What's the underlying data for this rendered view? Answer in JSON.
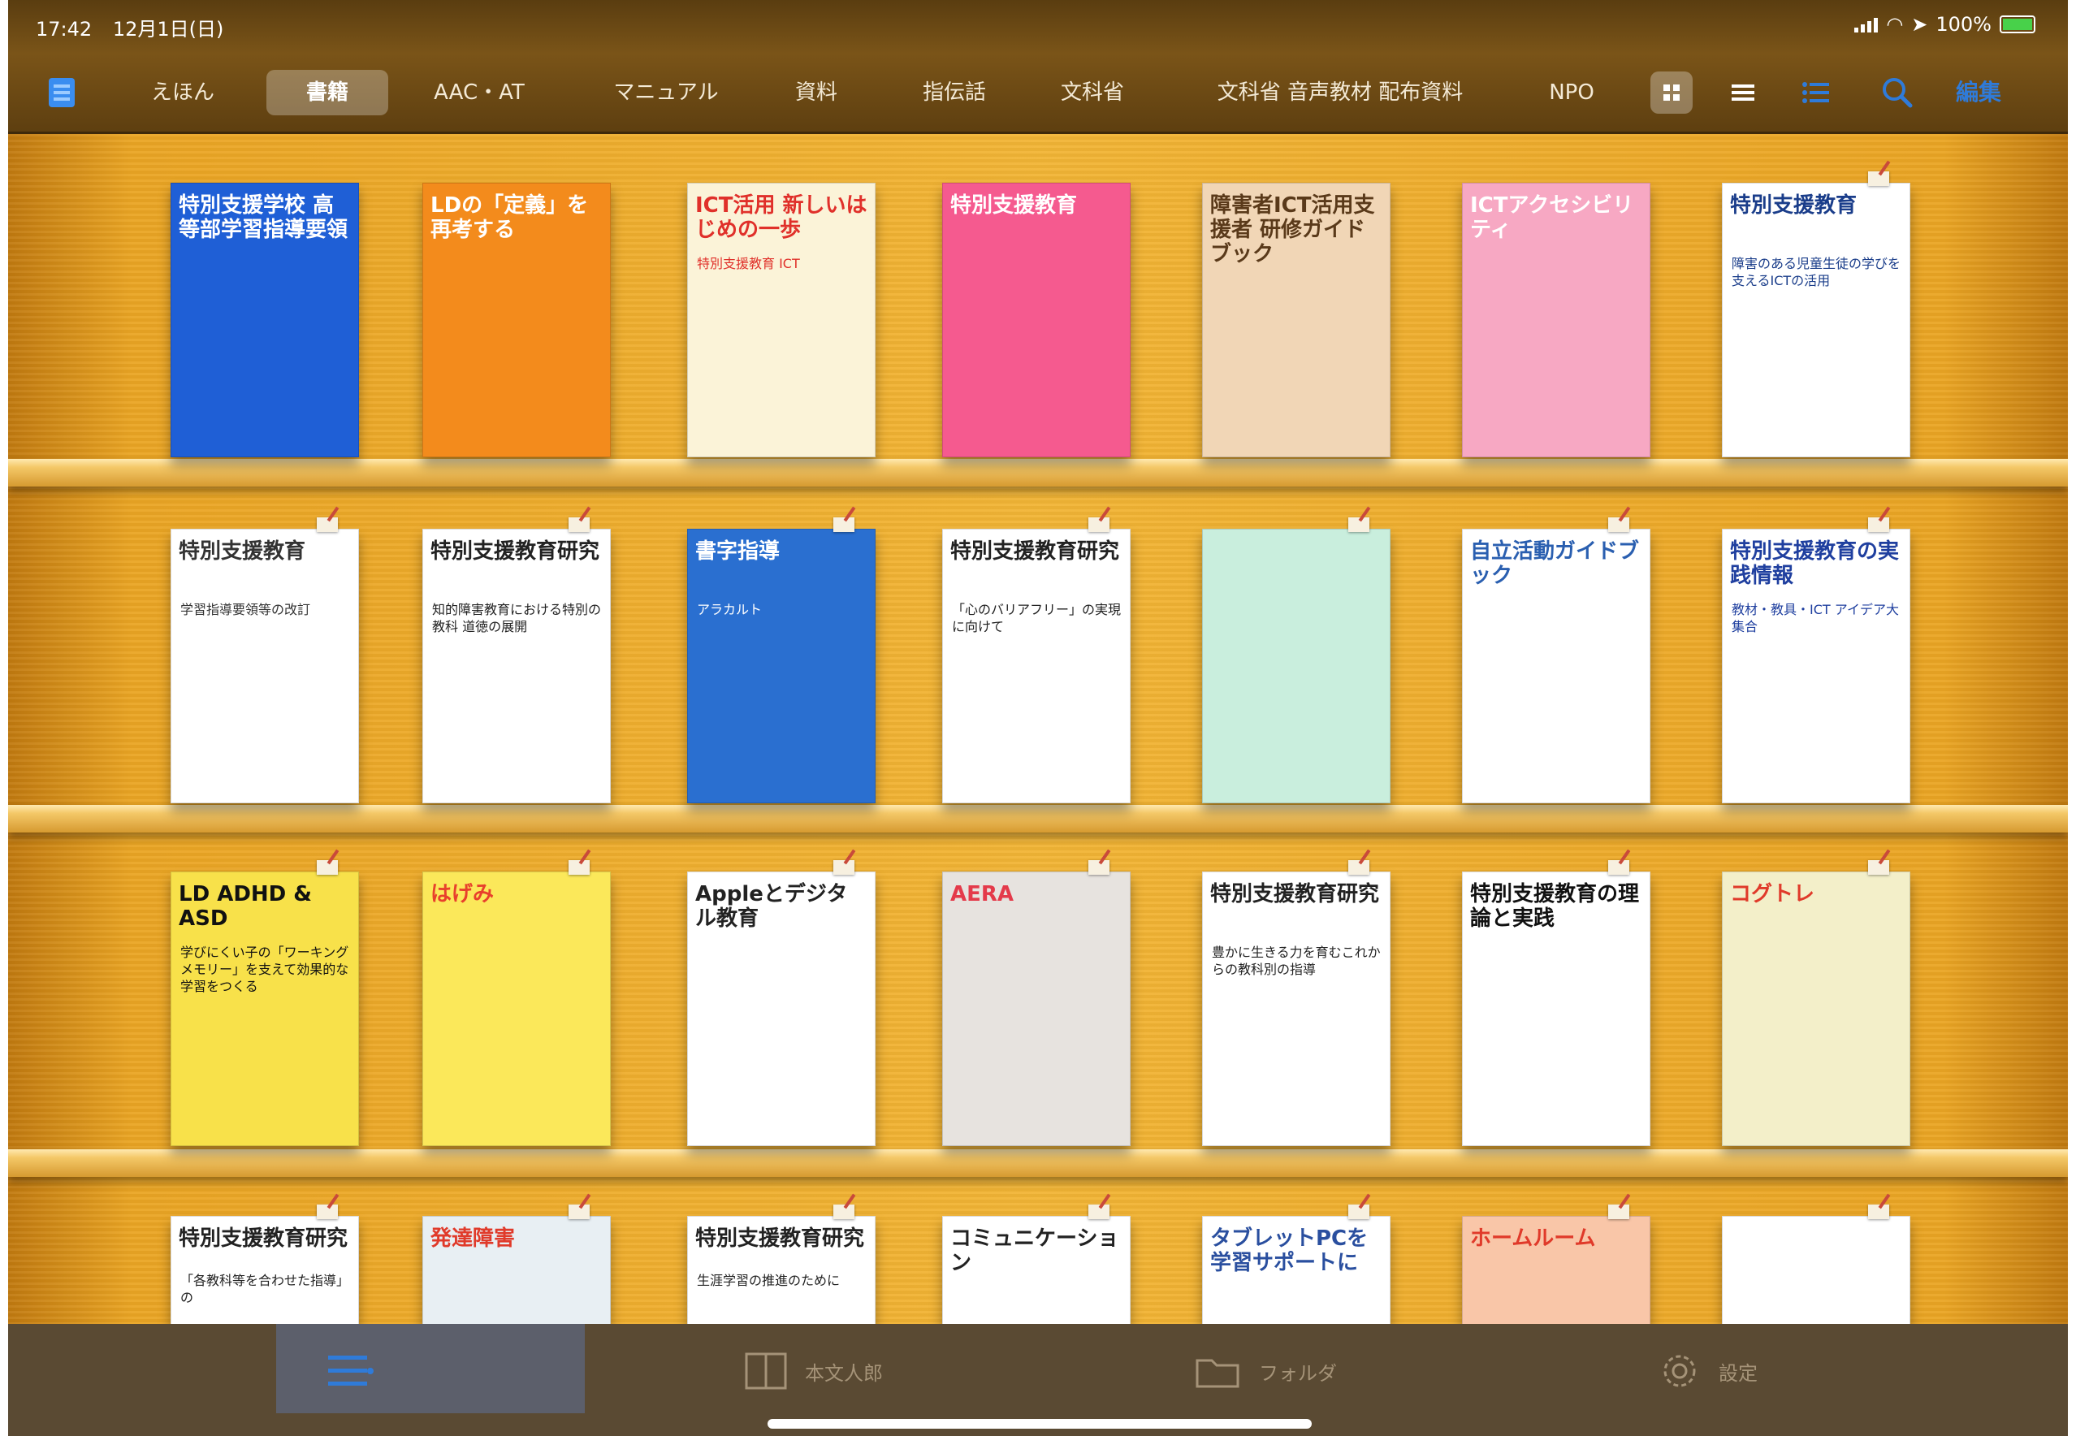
{
  "status_bar": {
    "time": "17:42",
    "date": "12月1日(日)",
    "battery": "100%"
  },
  "tabs": [
    {
      "label": "えほん",
      "active": false
    },
    {
      "label": "書籍",
      "active": true
    },
    {
      "label": "AAC・AT",
      "active": false
    },
    {
      "label": "マニュアル",
      "active": false
    },
    {
      "label": "資料",
      "active": false
    },
    {
      "label": "指伝話",
      "active": false
    },
    {
      "label": "文科省",
      "active": false
    },
    {
      "label": "文科省 音声教材 配布資料",
      "active": false
    },
    {
      "label": "NPO",
      "active": false
    }
  ],
  "toolbar": {
    "edit_label": "編集",
    "icons": [
      "library-icon",
      "grid-view-icon",
      "list-view-icon",
      "sort-list-icon",
      "search-icon"
    ]
  },
  "shelves": [
    {
      "books": [
        {
          "title": "特別支援学校 高等部学習指導要領",
          "subtitle": "",
          "bg": "#1f5fd6",
          "fg": "#ffffff"
        },
        {
          "title": "LDの「定義」を再考する",
          "subtitle": "",
          "bg": "#f38b1c",
          "fg": "#ffffff"
        },
        {
          "title": "ICT活用 新しいはじめの一歩",
          "subtitle": "特別支援教育 ICT",
          "bg": "#fbf3d8",
          "fg": "#e0302a"
        },
        {
          "title": "特別支援教育",
          "subtitle": "",
          "bg": "#f55a8f",
          "fg": "#ffffff"
        },
        {
          "title": "障害者ICT活用支援者 研修ガイドブック",
          "subtitle": "",
          "bg": "#f1d6b6",
          "fg": "#5a3a1a"
        },
        {
          "title": "ICTアクセシビリティ",
          "subtitle": "",
          "bg": "#f7a8c3",
          "fg": "#ffffff"
        },
        {
          "title": "特別支援教育",
          "subtitle": "障害のある児童生徒の学びを支えるICTの活用",
          "bg": "#ffffff",
          "fg": "#1a3d8a"
        }
      ]
    },
    {
      "books": [
        {
          "title": "特別支援教育",
          "subtitle": "学習指導要領等の改訂",
          "bg": "#ffffff",
          "fg": "#333333"
        },
        {
          "title": "特別支援教育研究",
          "subtitle": "知的障害教育における特別の教科 道徳の展開",
          "bg": "#ffffff",
          "fg": "#222222"
        },
        {
          "title": "書字指導",
          "subtitle": "アラカルト",
          "bg": "#2a6fd0",
          "fg": "#ffffff"
        },
        {
          "title": "特別支援教育研究",
          "subtitle": "「心のバリアフリー」の実現に向けて",
          "bg": "#ffffff",
          "fg": "#222222"
        },
        {
          "title": "",
          "subtitle": "",
          "bg": "#c9eedd",
          "fg": "#555555"
        },
        {
          "title": "自立活動ガイドブック",
          "subtitle": "",
          "bg": "#ffffff",
          "fg": "#2a5fb0"
        },
        {
          "title": "特別支援教育の実践情報",
          "subtitle": "教材・教具・ICT アイデア大集合",
          "bg": "#ffffff",
          "fg": "#1f3f9f"
        }
      ]
    },
    {
      "books": [
        {
          "title": "LD ADHD & ASD",
          "subtitle": "学びにくい子の「ワーキングメモリー」を支えて効果的な学習をつくる",
          "bg": "#f8e14a",
          "fg": "#111111"
        },
        {
          "title": "はげみ",
          "subtitle": "",
          "bg": "#fbe85a",
          "fg": "#e8402c"
        },
        {
          "title": "Appleとデジタル教育",
          "subtitle": "",
          "bg": "#ffffff",
          "fg": "#222222"
        },
        {
          "title": "AERA",
          "subtitle": "",
          "bg": "#e7e3df",
          "fg": "#e43a4a"
        },
        {
          "title": "特別支援教育研究",
          "subtitle": "豊かに生きる力を育むこれからの教科別の指導",
          "bg": "#ffffff",
          "fg": "#222222"
        },
        {
          "title": "特別支援教育の理論と実践",
          "subtitle": "",
          "bg": "#ffffff",
          "fg": "#111111"
        },
        {
          "title": "コグトレ",
          "subtitle": "",
          "bg": "#f3efc9",
          "fg": "#e03a2a"
        }
      ]
    },
    {
      "books": [
        {
          "title": "特別支援教育研究",
          "subtitle": "「各教科等を合わせた指導」の",
          "bg": "#ffffff",
          "fg": "#222222"
        },
        {
          "title": "発達障害",
          "subtitle": "",
          "bg": "#e8eff3",
          "fg": "#e03a2a"
        },
        {
          "title": "特別支援教育研究",
          "subtitle": "生涯学習の推進のために",
          "bg": "#ffffff",
          "fg": "#222222"
        },
        {
          "title": "コミュニケーション",
          "subtitle": "",
          "bg": "#ffffff",
          "fg": "#222222"
        },
        {
          "title": "タブレットPCを学習サポートに",
          "subtitle": "",
          "bg": "#ffffff",
          "fg": "#2a4f9f"
        },
        {
          "title": "ホームルーム",
          "subtitle": "",
          "bg": "#f9c6a8",
          "fg": "#e03a2a"
        },
        {
          "title": "",
          "subtitle": "",
          "bg": "#ffffff",
          "fg": "#555555"
        }
      ]
    }
  ],
  "bottom_tabs": [
    {
      "label": "",
      "icon": "bookshelf-icon",
      "active": true
    },
    {
      "label": "本文人郎",
      "icon": "reader-icon",
      "active": false
    },
    {
      "label": "フォルダ",
      "icon": "folder-icon",
      "active": false
    },
    {
      "label": "設定",
      "icon": "gear-icon",
      "active": false
    }
  ]
}
